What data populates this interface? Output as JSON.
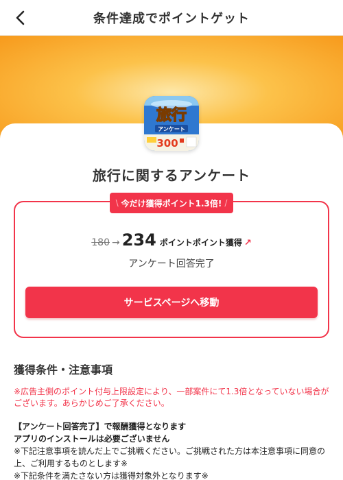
{
  "header": {
    "title": "条件達成でポイントゲット",
    "back_icon": "chevron-left-icon"
  },
  "hero": {
    "colors": {
      "center": "#fde7a8",
      "mid": "#fcc24a",
      "edge": "#f79a1c"
    }
  },
  "app_icon": {
    "name": "travel-survey-app-icon",
    "title_text": "旅行",
    "banner_text": "アンケート",
    "price_text": "300"
  },
  "survey": {
    "title": "旅行に関するアンケート"
  },
  "bonus": {
    "badge_text": "今だけ獲得ポイント1.3倍!",
    "slash_left": "\\",
    "slash_right": "/"
  },
  "points": {
    "old": "180",
    "arrow": "→",
    "new": "234",
    "label": "ポイントポイント獲得",
    "link_icon": "↗"
  },
  "status": {
    "complete_text": "アンケート回答完了"
  },
  "cta": {
    "label": "サービスページへ移動"
  },
  "conditions": {
    "title": "獲得条件・注意事項",
    "warning": "※広告主側のポイント付与上限設定により、一部案件にて1.3倍となっていない場合がございます。あらかじめご了承ください。",
    "line1": "【アンケート回答完了】で報酬獲得となります",
    "line2": "アプリのインストールは必要ございません",
    "line3": "※下記注意事項を読んだ上でご挑戦ください。ご挑戦された方は本注意事項に同意の上、ご利用するものとします※",
    "line4": "※下記条件を満たさない方は獲得対象外となります※"
  },
  "colors": {
    "accent": "#f2344a",
    "text": "#222222"
  }
}
